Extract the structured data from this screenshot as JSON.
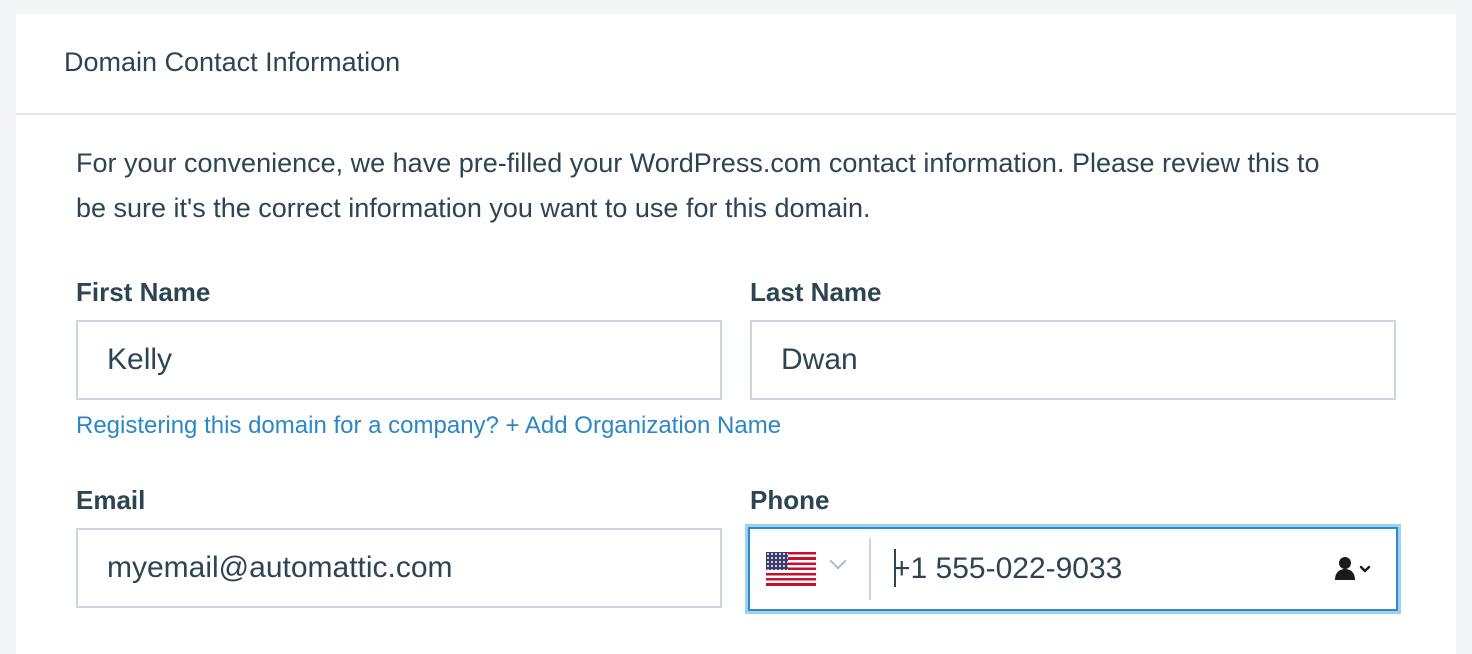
{
  "header": {
    "title": "Domain Contact Information"
  },
  "intro": {
    "text": "For your convenience, we have pre-filled your WordPress.com contact information. Please review this to be sure it's the correct information you want to use for this domain."
  },
  "fields": {
    "first_name": {
      "label": "First Name",
      "value": "Kelly"
    },
    "last_name": {
      "label": "Last Name",
      "value": "Dwan"
    },
    "email": {
      "label": "Email",
      "value": "myemail@automattic.com"
    },
    "phone": {
      "label": "Phone",
      "value": "+1 555-022-9033",
      "country_icon": "us-flag-icon",
      "picker_icon": "person-icon"
    }
  },
  "org_link": {
    "text": "Registering this domain for a company? + Add Organization Name"
  },
  "colors": {
    "text": "#2e4453",
    "link": "#2c87c7",
    "border": "#c8d7e1",
    "focus_border": "#2e8ac8",
    "focus_glow": "#9fd0f0",
    "page_bg": "#f3f5f6"
  }
}
